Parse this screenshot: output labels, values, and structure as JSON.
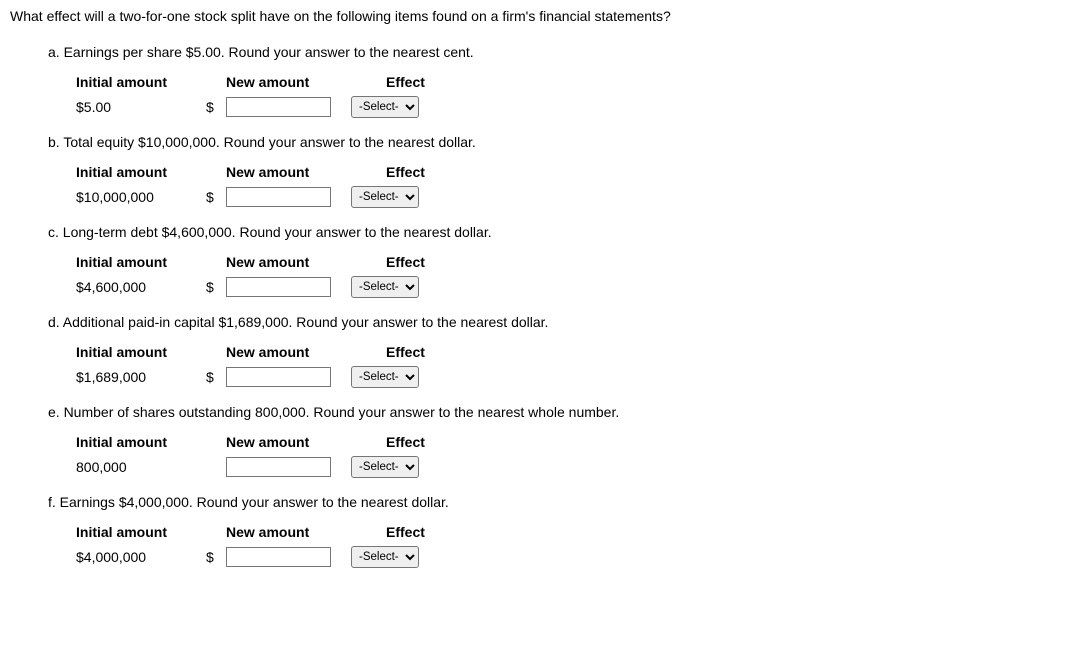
{
  "question": "What effect will a two-for-one stock split have on the following items found on a firm's financial statements?",
  "headers": {
    "initial": "Initial amount",
    "new": "New amount",
    "effect": "Effect"
  },
  "select_placeholder": "-Select-",
  "parts": {
    "a": {
      "text": "a. Earnings per share $5.00. Round your answer to the nearest cent.",
      "initial": "$5.00",
      "has_dollar": true
    },
    "b": {
      "text": "b. Total equity $10,000,000. Round your answer to the nearest dollar.",
      "initial": "$10,000,000",
      "has_dollar": true
    },
    "c": {
      "text": "c. Long-term debt $4,600,000. Round your answer to the nearest dollar.",
      "initial": "$4,600,000",
      "has_dollar": true
    },
    "d": {
      "text": "d. Additional paid-in capital $1,689,000. Round your answer to the nearest dollar.",
      "initial": "$1,689,000",
      "has_dollar": true
    },
    "e": {
      "text": "e. Number of shares outstanding 800,000. Round your answer to the nearest whole number.",
      "initial": "800,000",
      "has_dollar": false
    },
    "f": {
      "text": "f. Earnings $4,000,000. Round your answer to the nearest dollar.",
      "initial": "$4,000,000",
      "has_dollar": true
    }
  },
  "dollar_sign": "$"
}
